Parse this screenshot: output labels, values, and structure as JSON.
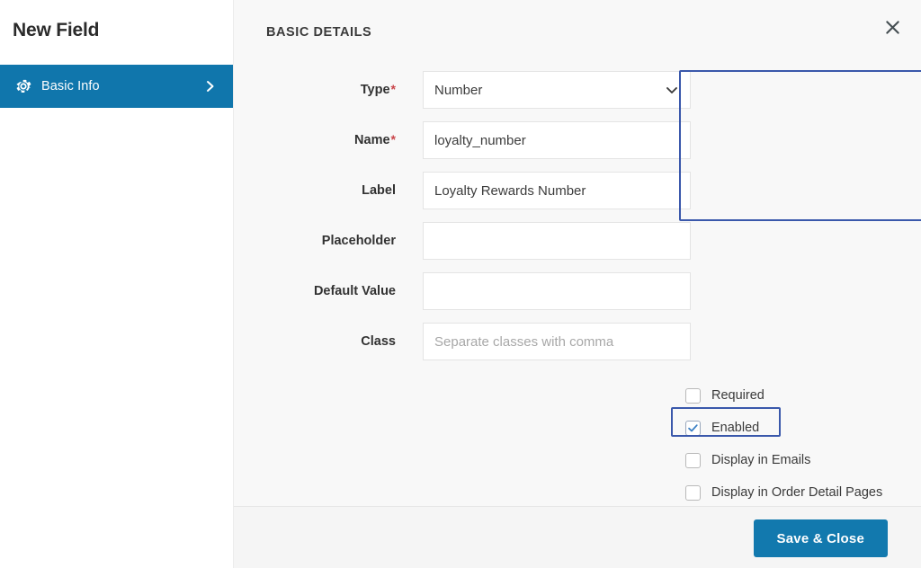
{
  "sidebar": {
    "title": "New Field",
    "items": [
      {
        "label": "Basic Info",
        "icon": "gear-icon",
        "chevron": "chevron-right-icon",
        "active": true,
        "active_color": "#1076ac"
      }
    ]
  },
  "panel": {
    "header": "BASIC DETAILS",
    "close_icon": "close-icon"
  },
  "form": {
    "fields": [
      {
        "label": "Type",
        "required": true,
        "control": "select",
        "value": "Number",
        "placeholder": "",
        "icon": "chevron-down-icon"
      },
      {
        "label": "Name",
        "required": true,
        "control": "text",
        "value": "loyalty_number",
        "placeholder": ""
      },
      {
        "label": "Label",
        "required": false,
        "control": "text",
        "value": "Loyalty Rewards Number",
        "placeholder": ""
      },
      {
        "label": "Placeholder",
        "required": false,
        "control": "text",
        "value": "",
        "placeholder": ""
      },
      {
        "label": "Default Value",
        "required": false,
        "control": "text",
        "value": "",
        "placeholder": ""
      },
      {
        "label": "Class",
        "required": false,
        "control": "text",
        "value": "",
        "placeholder": "Separate classes with comma"
      }
    ],
    "checkboxes": [
      {
        "label": "Required",
        "checked": false
      },
      {
        "label": "Enabled",
        "checked": true
      },
      {
        "label": "Display in Emails",
        "checked": false
      },
      {
        "label": "Display in Order Detail Pages",
        "checked": false
      }
    ]
  },
  "footer": {
    "save_label": "Save & Close",
    "button_color": "#1279ae"
  },
  "annotations": {
    "highlight_color": "#3a58ab",
    "arrow_color": "#3a54b4",
    "highlighted_regions": [
      "type-name-label-group",
      "enabled-checkbox"
    ],
    "arrow_points_to": "Save & Close"
  }
}
